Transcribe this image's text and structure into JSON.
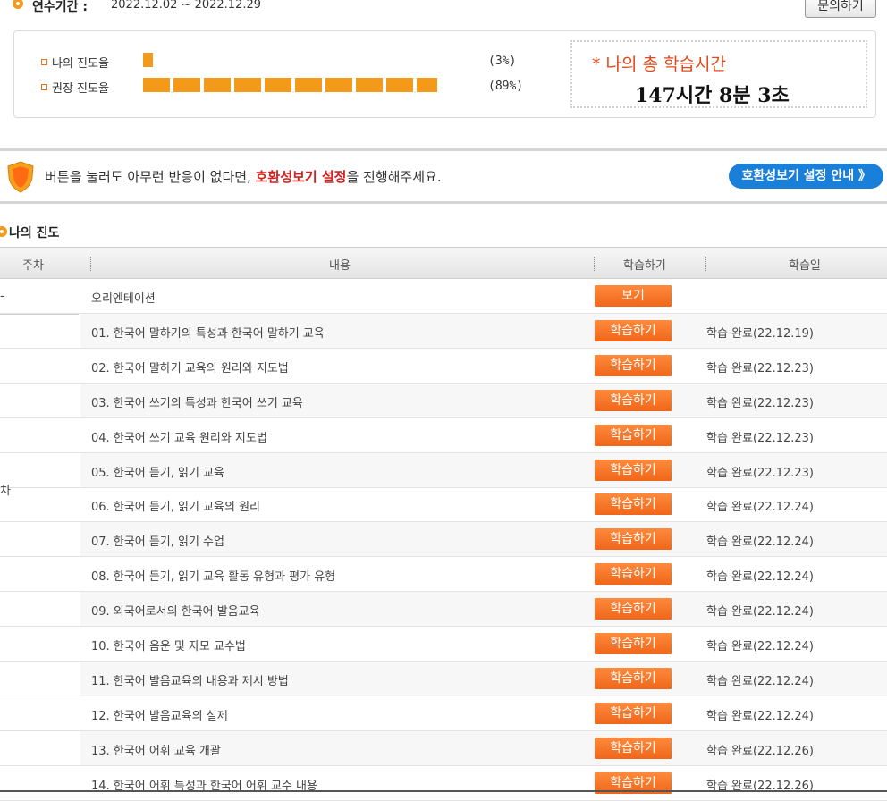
{
  "period": {
    "label": "연수기간 :",
    "value": "2022.12.02 ~ 2022.12.29"
  },
  "inquiry_button": "문의하기",
  "progress": {
    "mine": {
      "label": "나의 진도율",
      "value": 3,
      "display": "(3%)"
    },
    "recommended": {
      "label": "권장 진도율",
      "value": 89,
      "display": "(89%)"
    },
    "bar_color": "#f39a1a"
  },
  "total_time": {
    "title": "* 나의 총 학습시간",
    "value": "147시간 8분 3초"
  },
  "notice": {
    "text_before": "버튼을 눌러도 아무런 반응이 없다면, ",
    "highlight": "호환성보기 설정",
    "text_after": "을 진행해주세요.",
    "button": "호환성보기 설정 안내 》"
  },
  "section_title": "나의 진도",
  "table": {
    "headers": {
      "week": "주차",
      "content": "내용",
      "study": "학습하기",
      "date": "학습일"
    },
    "week_labels": {
      "first": "-",
      "second": "차"
    },
    "rows": [
      {
        "title": "오리엔테이션",
        "button": "보기",
        "status": ""
      },
      {
        "title": "01. 한국어 말하기의 특성과 한국어 말하기 교육",
        "button": "학습하기",
        "status": "학습 완료(22.12.19)"
      },
      {
        "title": "02. 한국어 말하기 교육의 원리와 지도법",
        "button": "학습하기",
        "status": "학습 완료(22.12.23)"
      },
      {
        "title": "03. 한국어 쓰기의 특성과 한국어 쓰기 교육",
        "button": "학습하기",
        "status": "학습 완료(22.12.23)"
      },
      {
        "title": "04. 한국어 쓰기 교육 원리와 지도법",
        "button": "학습하기",
        "status": "학습 완료(22.12.23)"
      },
      {
        "title": "05. 한국어 듣기, 읽기 교육",
        "button": "학습하기",
        "status": "학습 완료(22.12.23)"
      },
      {
        "title": "06. 한국어 듣기, 읽기 교육의 원리",
        "button": "학습하기",
        "status": "학습 완료(22.12.24)"
      },
      {
        "title": "07. 한국어 듣기, 읽기 수업",
        "button": "학습하기",
        "status": "학습 완료(22.12.24)"
      },
      {
        "title": "08. 한국어 듣기, 읽기 교육 활동 유형과 평가 유형",
        "button": "학습하기",
        "status": "학습 완료(22.12.24)"
      },
      {
        "title": "09. 외국어로서의 한국어 발음교육",
        "button": "학습하기",
        "status": "학습 완료(22.12.24)"
      },
      {
        "title": "10. 한국어 음운 및 자모 교수법",
        "button": "학습하기",
        "status": "학습 완료(22.12.24)"
      },
      {
        "title": "11. 한국어 발음교육의 내용과 제시 방법",
        "button": "학습하기",
        "status": "학습 완료(22.12.24)"
      },
      {
        "title": "12. 한국어 발음교육의 실제",
        "button": "학습하기",
        "status": "학습 완료(22.12.24)"
      },
      {
        "title": "13. 한국어 어휘 교육 개괄",
        "button": "학습하기",
        "status": "학습 완료(22.12.26)"
      },
      {
        "title": "14. 한국어 어휘 특성과 한국어 어휘 교수 내용",
        "button": "학습하기",
        "status": "학습 완료(22.12.26)"
      }
    ]
  }
}
